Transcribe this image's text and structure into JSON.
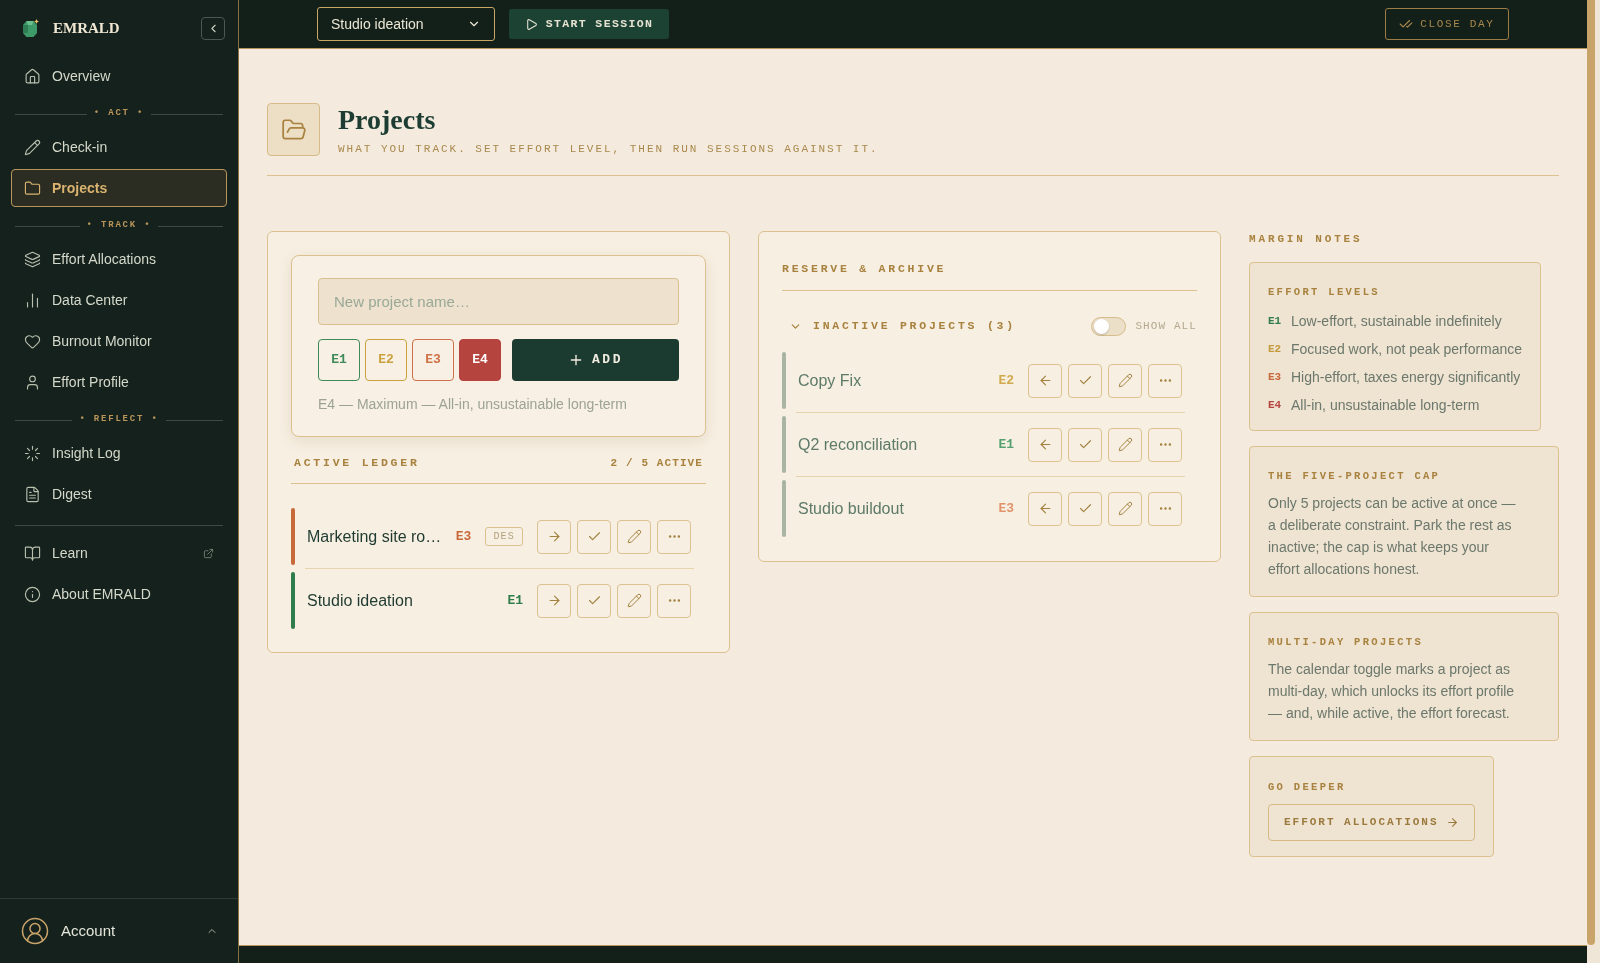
{
  "sidebar": {
    "brand": "EMRALD",
    "groups": [
      {
        "items": [
          {
            "label": "Overview",
            "kind": "link",
            "selected": false
          }
        ]
      },
      {
        "heading": "• ACT •",
        "items": [
          {
            "label": "Check-in",
            "kind": "link",
            "selected": false
          },
          {
            "label": "Projects",
            "kind": "link",
            "selected": true
          }
        ]
      },
      {
        "heading": "• TRACK •",
        "items": [
          {
            "label": "Effort Allocations",
            "kind": "link",
            "selected": false
          },
          {
            "label": "Data Center",
            "kind": "link",
            "selected": false
          },
          {
            "label": "Burnout Monitor",
            "kind": "link",
            "selected": false
          },
          {
            "label": "Effort Profile",
            "kind": "link",
            "selected": false
          }
        ]
      },
      {
        "heading": "• REFLECT •",
        "items": [
          {
            "label": "Insight Log",
            "kind": "link",
            "selected": false
          },
          {
            "label": "Digest",
            "kind": "link",
            "selected": false
          }
        ]
      },
      {
        "items": [
          {
            "label": "Learn",
            "kind": "external",
            "selected": false
          },
          {
            "label": "About EMRALD",
            "kind": "link",
            "selected": false
          }
        ]
      }
    ],
    "account": {
      "label": "Account"
    }
  },
  "topbar": {
    "project_select": {
      "value": "Studio ideation"
    },
    "start_button": {
      "label": "START SESSION"
    },
    "close_button": {
      "label": "CLOSE DAY"
    }
  },
  "header": {
    "title": "Projects",
    "subtitle": "WHAT YOU TRACK. SET EFFORT LEVEL, THEN RUN SESSIONS AGAINST IT."
  },
  "new_project": {
    "placeholder": "New project name…",
    "levels": [
      {
        "label": "E1",
        "color": "#3f8a59",
        "selected": false
      },
      {
        "label": "E2",
        "color": "#c9a13f",
        "selected": false
      },
      {
        "label": "E3",
        "color": "#cf7247",
        "selected": false
      },
      {
        "label": "E4",
        "color": "#b5443f",
        "selected": true
      }
    ],
    "add_button": "ADD",
    "caption": "E4 — Maximum — All-in, unsustainable long-term"
  },
  "active_ledger": {
    "title": "ACTIVE LEDGER",
    "count": "2 / 5 ACTIVE",
    "rows": [
      {
        "name": "Marketing site ro…",
        "effort": "E3",
        "color": "#c8693a",
        "tag": "DES"
      },
      {
        "name": "Studio ideation",
        "effort": "E1",
        "color": "#2f7d4a"
      }
    ]
  },
  "reserve": {
    "title": "RESERVE & ARCHIVE",
    "inactive": {
      "label": "INACTIVE PROJECTS (3)",
      "expanded": true,
      "show_all": {
        "label": "SHOW ALL",
        "on": false
      },
      "rows": [
        {
          "name": "Copy Fix",
          "effort": "E2",
          "color": "#d2a94c"
        },
        {
          "name": "Q2 reconciliation",
          "effort": "E1",
          "color": "#55a06f"
        },
        {
          "name": "Studio buildout",
          "effort": "E3",
          "color": "#e0946c"
        }
      ]
    }
  },
  "margin_notes": {
    "title": "MARGIN NOTES",
    "cards": [
      {
        "kind": "levels",
        "title": "EFFORT LEVELS",
        "items": [
          {
            "code": "E1",
            "color": "#2f7d4a",
            "text": "Low-effort, sustainable indefinitely"
          },
          {
            "code": "E2",
            "color": "#c49a3c",
            "text": "Focused work, not peak performance"
          },
          {
            "code": "E3",
            "color": "#c8693a",
            "text": "High-effort, taxes energy significantly"
          },
          {
            "code": "E4",
            "color": "#b5443f",
            "text": "All-in, unsustainable long-term"
          }
        ]
      },
      {
        "kind": "text",
        "title": "THE FIVE-PROJECT CAP",
        "body": "Only 5 projects can be active at once — a deliberate constraint. Park the rest as inactive; the cap is what keeps your effort allocations honest."
      },
      {
        "kind": "text",
        "title": "MULTI-DAY PROJECTS",
        "body": "The calendar toggle marks a project as multi-day, which unlocks its effort profile — and, while active, the effort forecast."
      },
      {
        "kind": "link",
        "title": "GO DEEPER",
        "button": "EFFORT ALLOCATIONS"
      }
    ]
  }
}
